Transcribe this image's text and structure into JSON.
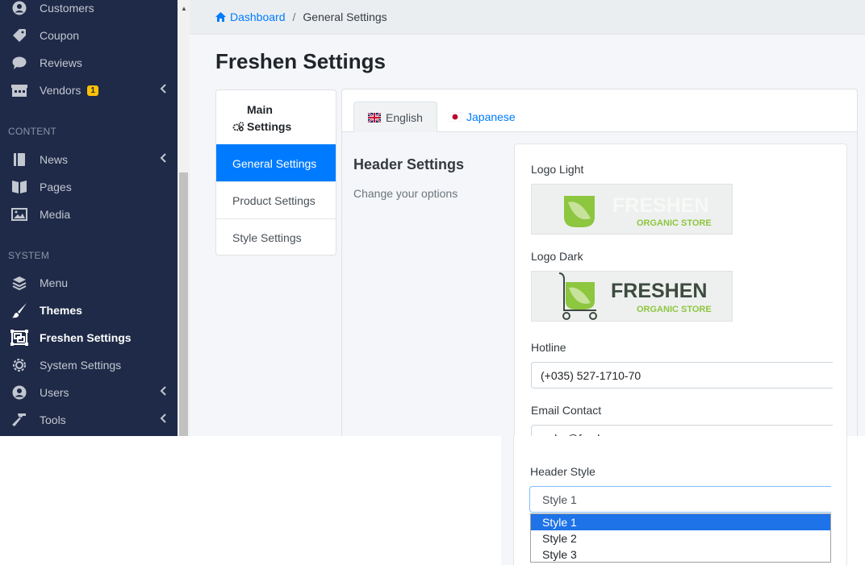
{
  "sidebar": {
    "items": [
      {
        "label": "Customers",
        "icon": "user-circle-icon"
      },
      {
        "label": "Coupon",
        "icon": "tags-icon"
      },
      {
        "label": "Reviews",
        "icon": "comment-icon"
      },
      {
        "label": "Vendors",
        "icon": "store-icon",
        "badge": "1"
      },
      {
        "label": "News",
        "icon": "book-icon"
      },
      {
        "label": "Pages",
        "icon": "book-open-icon"
      },
      {
        "label": "Media",
        "icon": "image-icon"
      },
      {
        "label": "Menu",
        "icon": "layers-icon"
      },
      {
        "label": "Themes",
        "icon": "paint-brush-icon"
      },
      {
        "label": "Freshen Settings",
        "icon": "object-group-icon"
      },
      {
        "label": "System Settings",
        "icon": "cog-icon"
      },
      {
        "label": "Users",
        "icon": "users-icon"
      },
      {
        "label": "Tools",
        "icon": "hammer-icon"
      }
    ],
    "headers": {
      "content": "CONTENT",
      "system": "SYSTEM"
    }
  },
  "breadcrumb": {
    "home": "Dashboard",
    "separator": "/",
    "current": "General Settings"
  },
  "page_title": "Freshen Settings",
  "settings_menu": {
    "heading": "Main Settings",
    "items": [
      "General Settings",
      "Product Settings",
      "Style Settings"
    ]
  },
  "tabs": [
    {
      "label": "English",
      "flag": "uk-flag-icon"
    },
    {
      "label": "Japanese",
      "flag": "japan-flag-icon"
    }
  ],
  "section": {
    "title": "Header Settings",
    "description": "Change your options"
  },
  "form": {
    "logo_light_label": "Logo Light",
    "logo_dark_label": "Logo Dark",
    "logo_text": "FRESHEN",
    "logo_subtext": "ORGANIC STORE",
    "hotline_label": "Hotline",
    "hotline_value": "(+035) 527-1710-70",
    "email_label": "Email Contact",
    "email_value": "order@freshen.com",
    "header_style_label": "Header Style",
    "header_style_value": "Style 1",
    "header_style_options": [
      "Style 1",
      "Style 2",
      "Style 3"
    ]
  },
  "colors": {
    "sidebar_bg": "#1f2a48",
    "accent": "#007bff",
    "badge": "#ffc107",
    "logo_green": "#8dc63f",
    "logo_dark_text": "#3d4a3f"
  }
}
